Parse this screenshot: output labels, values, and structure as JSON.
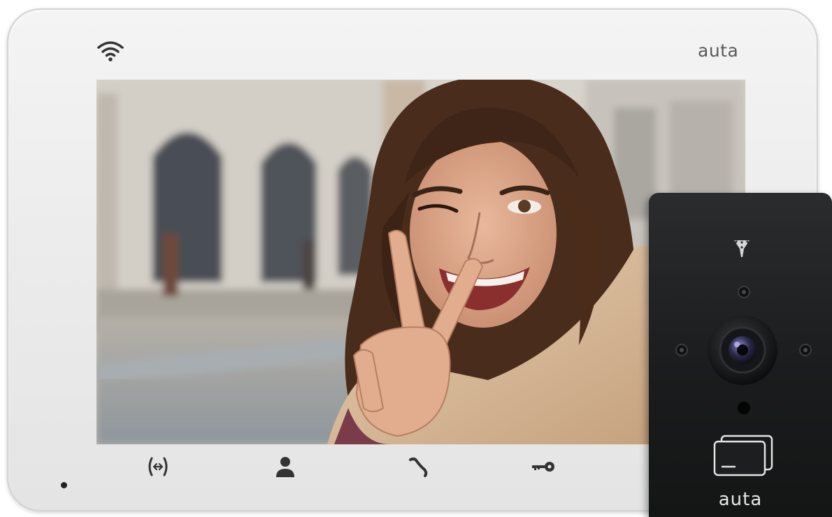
{
  "monitor": {
    "brand": "auta",
    "status_icon": "wifi-icon",
    "buttons": [
      {
        "id": "intercom",
        "icon": "intercom-arrows-icon"
      },
      {
        "id": "user",
        "icon": "user-icon"
      },
      {
        "id": "call",
        "icon": "handset-icon"
      },
      {
        "id": "unlock",
        "icon": "key-icon"
      }
    ],
    "colors": {
      "body": "#ececec",
      "icons": "#333333"
    }
  },
  "door_station": {
    "brand": "auta",
    "icons": [
      "antenna-icon",
      "camera-lens-icon",
      "card-reader-icon"
    ],
    "colors": {
      "panel": "#1d1e1f",
      "text": "#e6e6e6"
    }
  }
}
